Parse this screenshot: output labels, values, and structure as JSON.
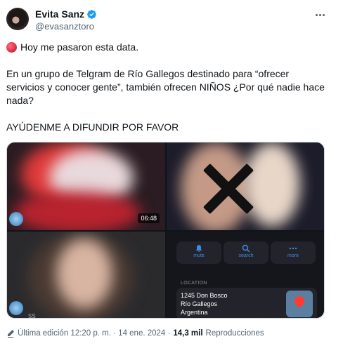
{
  "author": {
    "display_name": "Evita Sanz",
    "handle": "@evasanztoro",
    "verified_icon": "verified-badge-icon",
    "verified_color": "#1d9bf0"
  },
  "tweet": {
    "line1": "Hoy me pasaron esta data.",
    "line1_emoji": "red-circle-icon",
    "line2": "En un grupo de Telgram de Río Gallegos destinado para “ofrecer servicios y conocer gente”, también ofrecen NIÑOS ¿Por qué nadie hace nada?",
    "line3": "AYÚDENME A DIFUNDIR POR FAVOR"
  },
  "media": {
    "video_duration": "06:48",
    "ss_label": "SS",
    "telegram": {
      "buttons": [
        "mute",
        "search",
        "more"
      ],
      "location_label": "LOCATION",
      "address_line1": "1245 Don Bosco",
      "address_line2": "Río Gallegos",
      "address_line3": "Argentina"
    }
  },
  "footer": {
    "edited": "Última edición 12:20 p. m. · 14 ene. 2024 ·",
    "views_count": "14,3 mil",
    "views_label": "Reproducciones"
  }
}
